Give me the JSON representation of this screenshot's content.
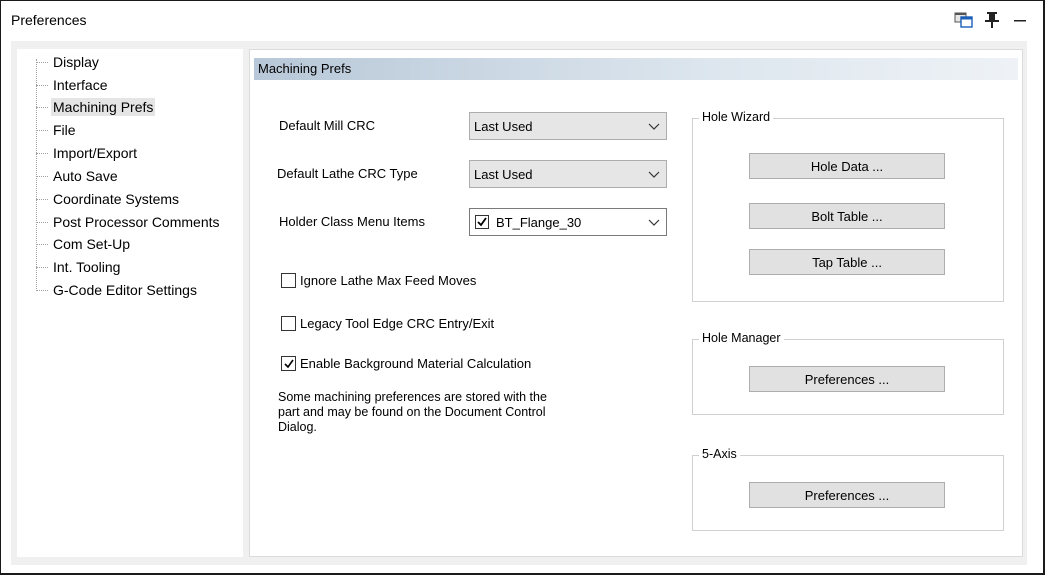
{
  "window": {
    "title": "Preferences"
  },
  "titlebar_icons": [
    "layout-icon",
    "pin-icon",
    "minimize-icon"
  ],
  "tree": {
    "items": [
      {
        "label": "Display",
        "selected": false
      },
      {
        "label": "Interface",
        "selected": false
      },
      {
        "label": "Machining Prefs",
        "selected": true
      },
      {
        "label": "File",
        "selected": false
      },
      {
        "label": "Import/Export",
        "selected": false
      },
      {
        "label": "Auto Save",
        "selected": false
      },
      {
        "label": "Coordinate Systems",
        "selected": false
      },
      {
        "label": "Post Processor Comments",
        "selected": false
      },
      {
        "label": "Com Set-Up",
        "selected": false
      },
      {
        "label": "Int. Tooling",
        "selected": false
      },
      {
        "label": "G-Code Editor Settings",
        "selected": false
      }
    ]
  },
  "panel": {
    "header": "Machining Prefs",
    "fields": {
      "mill_crc": {
        "label": "Default Mill CRC",
        "value": "Last Used"
      },
      "lathe_crc": {
        "label": "Default Lathe CRC Type",
        "value": "Last Used"
      },
      "holder_class": {
        "label": "Holder Class Menu Items",
        "value": "BT_Flange_30",
        "checked": true
      }
    },
    "checkboxes": [
      {
        "label": "Ignore Lathe Max Feed Moves",
        "checked": false
      },
      {
        "label": "Legacy Tool Edge CRC Entry/Exit",
        "checked": false
      },
      {
        "label": "Enable Background Material Calculation",
        "checked": true
      }
    ],
    "note": "Some machining preferences are stored with the part and may be found on the Document Control Dialog.",
    "groups": {
      "hole_wizard": {
        "title": "Hole Wizard",
        "buttons": [
          "Hole Data ...",
          "Bolt Table ...",
          "Tap Table ..."
        ]
      },
      "hole_manager": {
        "title": "Hole Manager",
        "buttons": [
          "Preferences ..."
        ]
      },
      "five_axis": {
        "title": "5-Axis",
        "buttons": [
          "Preferences ..."
        ]
      }
    }
  }
}
